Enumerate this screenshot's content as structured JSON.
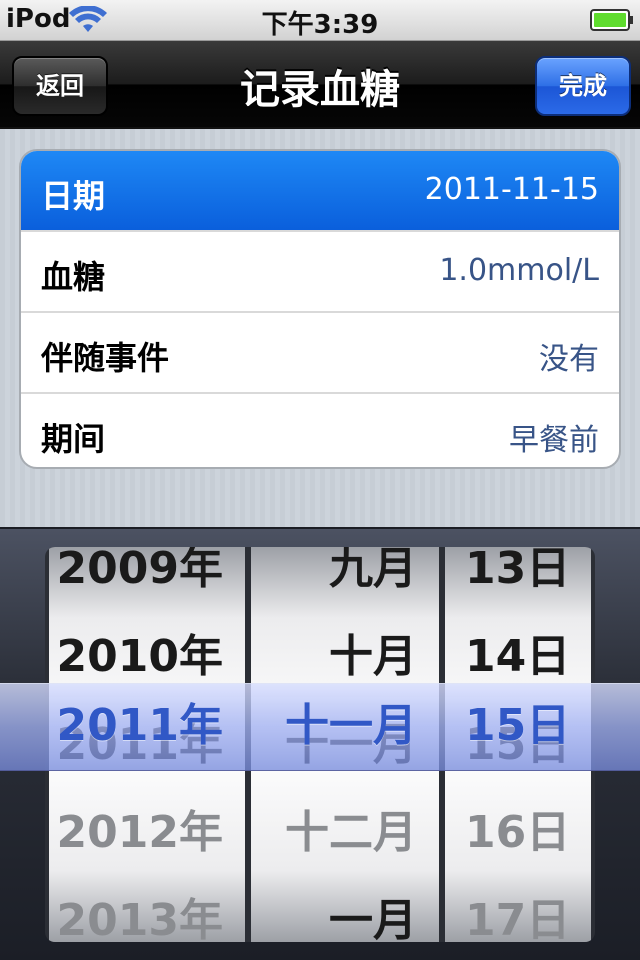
{
  "status_bar": {
    "carrier": "iPod",
    "time": "下午3:39",
    "icons": [
      "wifi-icon",
      "battery-icon"
    ],
    "battery_color": "#5fdc2e"
  },
  "nav": {
    "title": "记录血糖",
    "back_label": "返回",
    "done_label": "完成"
  },
  "form": {
    "rows": [
      {
        "label": "日期",
        "value": "2011-11-15",
        "selected": true
      },
      {
        "label": "血糖",
        "value": "1.0mmol/L"
      },
      {
        "label": "伴随事件",
        "value": "没有"
      },
      {
        "label": "期间",
        "value": "早餐前"
      }
    ]
  },
  "picker": {
    "years": [
      "2009年",
      "2010年",
      "2011年",
      "2012年",
      "2013年"
    ],
    "months": [
      "九月",
      "十月",
      "十一月",
      "十二月",
      "一月"
    ],
    "days": [
      "13日",
      "14日",
      "15日",
      "16日",
      "17日"
    ],
    "selected": {
      "year": "2011年",
      "month": "十一月",
      "day": "15日"
    }
  },
  "colors": {
    "selected_row": "#1e88f5",
    "value_text": "#385487",
    "picker_selected": "#3158c6",
    "done_button": "#2e6fe6"
  }
}
